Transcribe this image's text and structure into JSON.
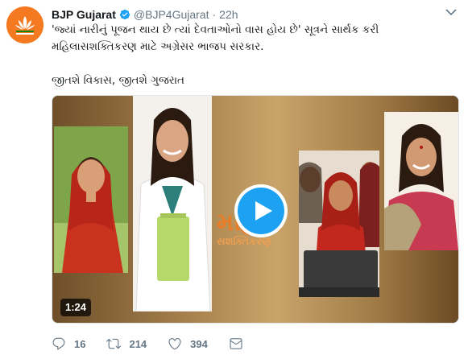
{
  "tweet": {
    "author_name": "BJP Gujarat",
    "handle": "@BJP4Gujarat",
    "separator": "·",
    "time": "22h",
    "text_line1": "'જ્યાં નારીનું પૂજન થાય છે ત્યાં દેવતાઓનો વાસ હોય છે' સૂત્રને સાર્થક કરી",
    "text_line2": "મહિલાસશક્તિકરણ માટે અગ્રેસર ભાજપ સરકાર.",
    "text_line3": "જીતશે વિકાસ, જીતશે ગુજરાત"
  },
  "media": {
    "overlay_title": "મહિલા",
    "overlay_subtitle": "સશક્તિકરણ",
    "duration": "1:24"
  },
  "actions": {
    "reply_count": "16",
    "retweet_count": "214",
    "like_count": "394"
  },
  "icons": {
    "avatar": "bjp-lotus-logo",
    "verified": "verified-badge-icon",
    "caret": "chevron-down-icon",
    "play": "play-icon",
    "reply": "reply-icon",
    "retweet": "retweet-icon",
    "like": "heart-icon",
    "dm": "envelope-icon"
  },
  "colors": {
    "accent": "#1da1f2",
    "muted": "#657786",
    "brand": "#f47920"
  }
}
